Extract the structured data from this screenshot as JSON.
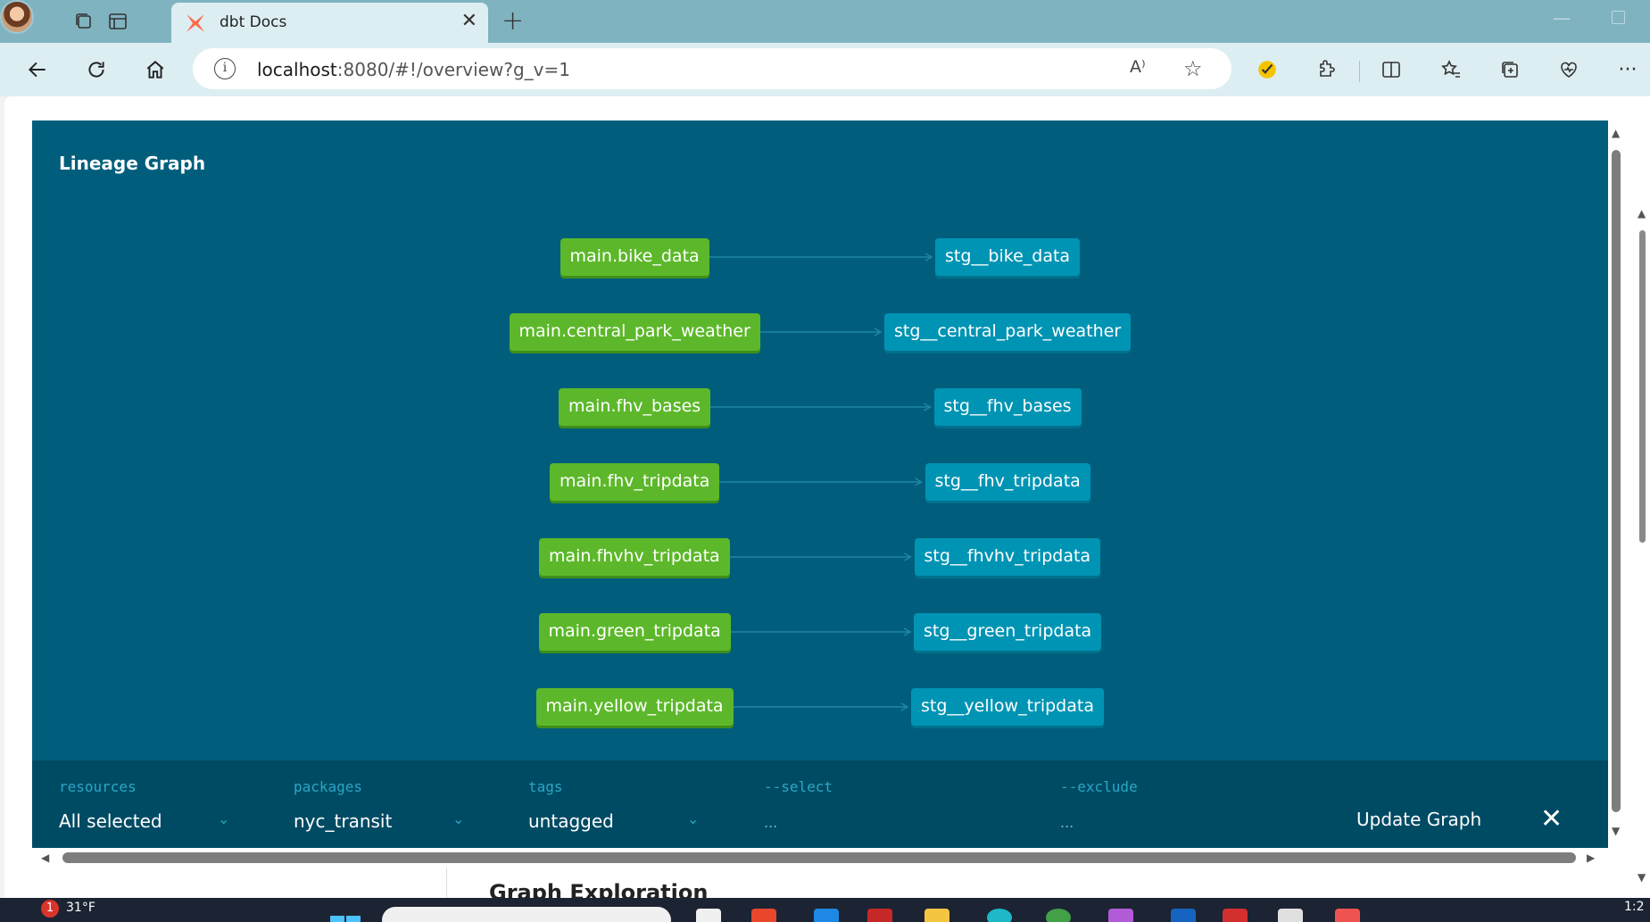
{
  "browser": {
    "tab_title": "dbt Docs",
    "new_tab_symbol": "+",
    "close_symbol": "✕",
    "url_host": "localhost",
    "url_rest": ":8080/#!/overview?g_v=1",
    "read_aloud_symbol": "A⁾",
    "more_symbol": "···"
  },
  "panel": {
    "title": "Lineage Graph",
    "source_nodes": [
      "main.bike_data",
      "main.central_park_weather",
      "main.fhv_bases",
      "main.fhv_tripdata",
      "main.fhvhv_tripdata",
      "main.green_tripdata",
      "main.yellow_tripdata"
    ],
    "staging_nodes": [
      "stg__bike_data",
      "stg__central_park_weather",
      "stg__fhv_bases",
      "stg__fhv_tripdata",
      "stg__fhvhv_tripdata",
      "stg__green_tripdata",
      "stg__yellow_tripdata"
    ]
  },
  "controls": {
    "resources_label": "resources",
    "resources_value": "All selected",
    "packages_label": "packages",
    "packages_value": "nyc_transit",
    "tags_label": "tags",
    "tags_value": "untagged",
    "select_label": "--select",
    "select_placeholder": "...",
    "exclude_label": "--exclude",
    "exclude_placeholder": "...",
    "update_label": "Update Graph",
    "close_symbol": "✕"
  },
  "page_behind": {
    "heading_partial": "Graph Exploration"
  },
  "taskbar": {
    "notification_count": "1",
    "temperature": "31°F",
    "clock": "1:2"
  },
  "colors": {
    "panel_bg": "#005e7c",
    "source_node": "#5cb82a",
    "staging_node": "#0094b4",
    "controls_bg": "#004b64",
    "tab_strip": "#80b3c0"
  }
}
